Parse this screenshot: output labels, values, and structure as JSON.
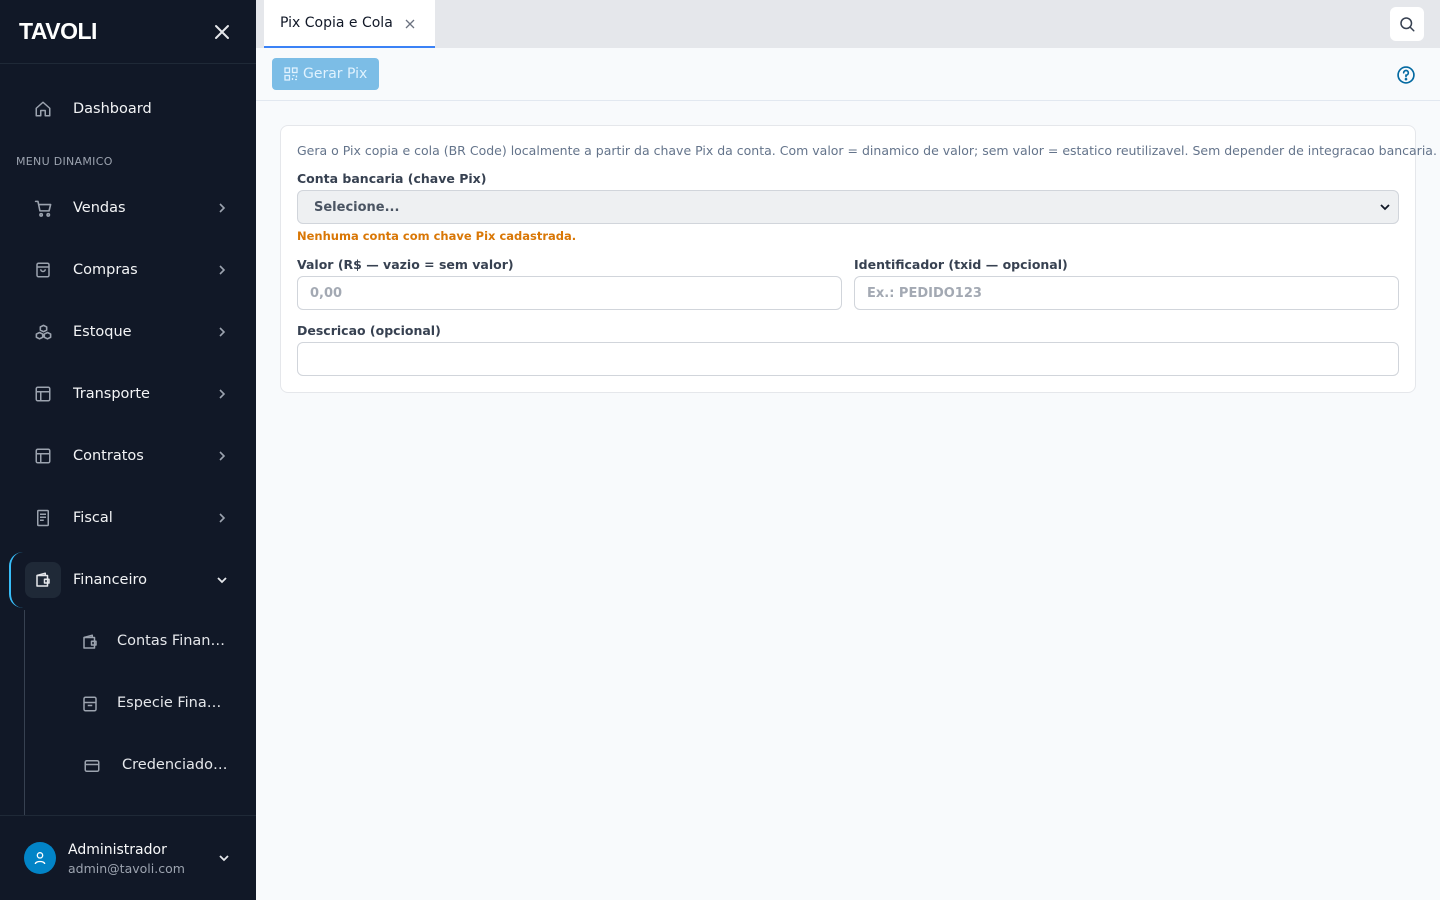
{
  "brand": {
    "logo": "TAVOLI"
  },
  "sidebar": {
    "dashboard": "Dashboard",
    "section_title": "MENU DINAMICO",
    "items": [
      {
        "label": "Vendas",
        "icon": "cart-icon"
      },
      {
        "label": "Compras",
        "icon": "bag-icon"
      },
      {
        "label": "Estoque",
        "icon": "boxes-icon"
      },
      {
        "label": "Transporte",
        "icon": "layout-icon"
      },
      {
        "label": "Contratos",
        "icon": "layout-icon"
      },
      {
        "label": "Fiscal",
        "icon": "receipt-icon"
      },
      {
        "label": "Financeiro",
        "icon": "wallet-icon",
        "expanded": true
      }
    ],
    "sub_items": [
      {
        "label": "Contas Financeiras",
        "icon": "wallet-icon"
      },
      {
        "label": "Especie Financeira",
        "icon": "archive-icon"
      },
      {
        "label": "Credenciadoras",
        "icon": "credit-card-icon"
      }
    ]
  },
  "user": {
    "name": "Administrador",
    "email": "admin@tavoli.com"
  },
  "tabs": [
    {
      "label": "Pix Copia e Cola",
      "active": true
    }
  ],
  "toolbar": {
    "generate_label": "Gerar Pix"
  },
  "form": {
    "description": "Gera o Pix copia e cola (BR Code) localmente a partir da chave Pix da conta. Com valor = dinamico de valor; sem valor = estatico reutilizavel. Sem depender de integracao bancaria.",
    "account_label": "Conta bancaria (chave Pix)",
    "account_value": "Selecione...",
    "account_warning": "Nenhuma conta com chave Pix cadastrada.",
    "value_label": "Valor (R$ — vazio = sem valor)",
    "value_placeholder": "0,00",
    "txid_label": "Identificador (txid — opcional)",
    "txid_placeholder": "Ex.: PEDIDO123",
    "desc_label": "Descricao (opcional)",
    "desc_value": ""
  },
  "colors": {
    "sidebar_bg": "#111827",
    "accent": "#3b82f6",
    "button": "#7cbde6",
    "warning": "#d97706"
  }
}
